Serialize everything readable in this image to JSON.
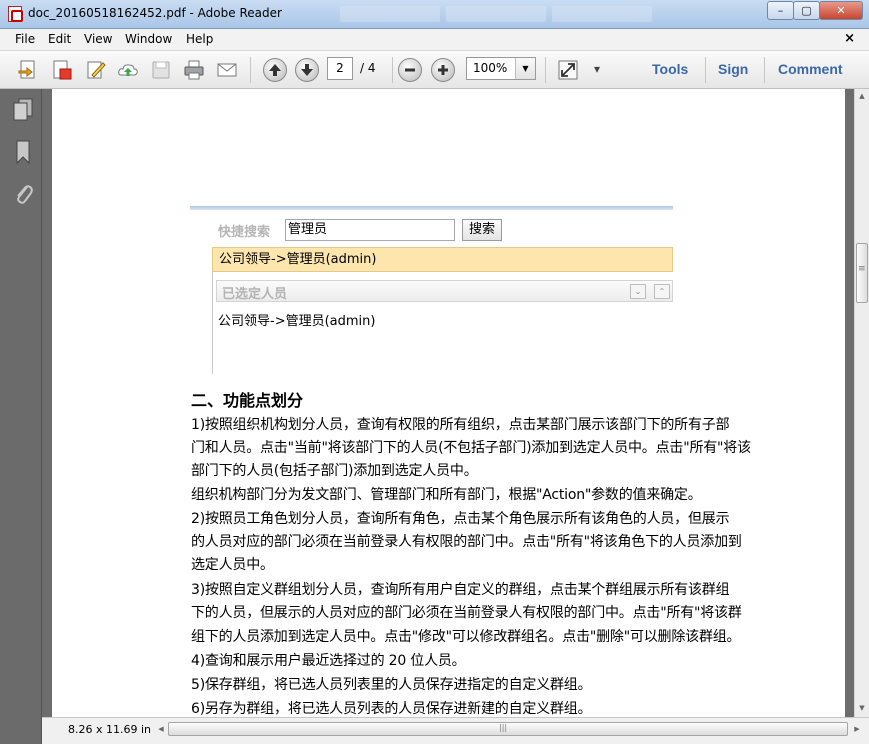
{
  "window": {
    "title": "doc_20160518162452.pdf - Adobe Reader",
    "minimize_glyph": "–",
    "maximize_glyph": "▢",
    "close_glyph": "✕"
  },
  "menu": {
    "items": [
      "File",
      "Edit",
      "View",
      "Window",
      "Help"
    ],
    "close_doc_glyph": "×"
  },
  "toolbar": {
    "current_page": "2",
    "page_total": "/ 4",
    "zoom": "100%",
    "zoom_dropdown_glyph": "▼",
    "more_glyph": "▾",
    "links": [
      "Tools",
      "Sign",
      "Comment"
    ]
  },
  "document": {
    "embedded_ui": {
      "search_label": "快捷搜索",
      "search_value": "管理员",
      "search_button": "搜索",
      "selected_row": "公司领导->管理员(admin)",
      "panel_title": "已选定人员",
      "panel_btn_down": "⌄",
      "panel_btn_up": "⌃",
      "person": "公司领导->管理员(admin)"
    },
    "heading": "二、功能点划分",
    "lines": [
      "1)按照组织机构划分人员，查询有权限的所有组织，点击某部门展示该部门下的所有子部",
      "门和人员。点击\"当前\"将该部门下的人员(不包括子部门)添加到选定人员中。点击\"所有\"将该",
      "部门下的人员(包括子部门)添加到选定人员中。",
      "组织机构部门分为发文部门、管理部门和所有部门，根据\"Action\"参数的值来确定。",
      "2)按照员工角色划分人员，查询所有角色，点击某个角色展示所有该角色的人员，但展示",
      "的人员对应的部门必须在当前登录人有权限的部门中。点击\"所有\"将该角色下的人员添加到",
      "选定人员中。",
      "3)按照自定义群组划分人员，查询所有用户自定义的群组，点击某个群组展示所有该群组",
      "下的人员，但展示的人员对应的部门必须在当前登录人有权限的部门中。点击\"所有\"将该群",
      "组下的人员添加到选定人员中。点击\"修改\"可以修改群组名。点击\"删除\"可以删除该群组。",
      "4)查询和展示用户最近选择过的 20 位人员。",
      "5)保存群组，将已选人员列表里的人员保存进指定的自定义群组。",
      "6)另存为群组，将已选人员列表的人员保存进新建的自定义群组。"
    ]
  },
  "status": {
    "page_size": "8.26 x 11.69 in",
    "hscroll_grip": "|||",
    "vscroll_grip": "≡",
    "arrow_up": "▲",
    "arrow_down": "▼",
    "arrow_left": "◀",
    "arrow_right": "▶"
  }
}
